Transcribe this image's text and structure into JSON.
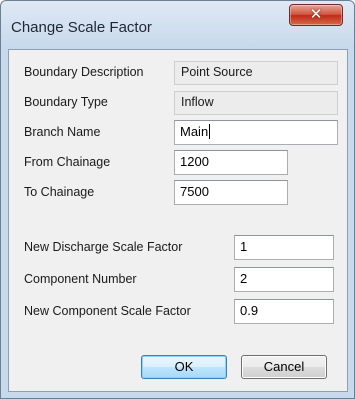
{
  "window": {
    "title": "Change Scale Factor",
    "close_glyph": "✕",
    "close_icon": "close-icon"
  },
  "fields": {
    "boundary_description": {
      "label": "Boundary Description",
      "value": "Point Source"
    },
    "boundary_type": {
      "label": "Boundary Type",
      "value": "Inflow"
    },
    "branch_name": {
      "label": "Branch Name",
      "value": "Main"
    },
    "from_chainage": {
      "label": "From Chainage",
      "value": "1200"
    },
    "to_chainage": {
      "label": "To Chainage",
      "value": "7500"
    },
    "new_discharge_scale_factor": {
      "label": "New Discharge Scale Factor",
      "value": "1"
    },
    "component_number": {
      "label": "Component Number",
      "value": "2"
    },
    "new_component_scale_factor": {
      "label": "New Component Scale Factor",
      "value": "0.9"
    }
  },
  "buttons": {
    "ok": "OK",
    "cancel": "Cancel"
  },
  "colors": {
    "close_button": "#c12a15",
    "default_button_border": "#3c7fb1"
  }
}
